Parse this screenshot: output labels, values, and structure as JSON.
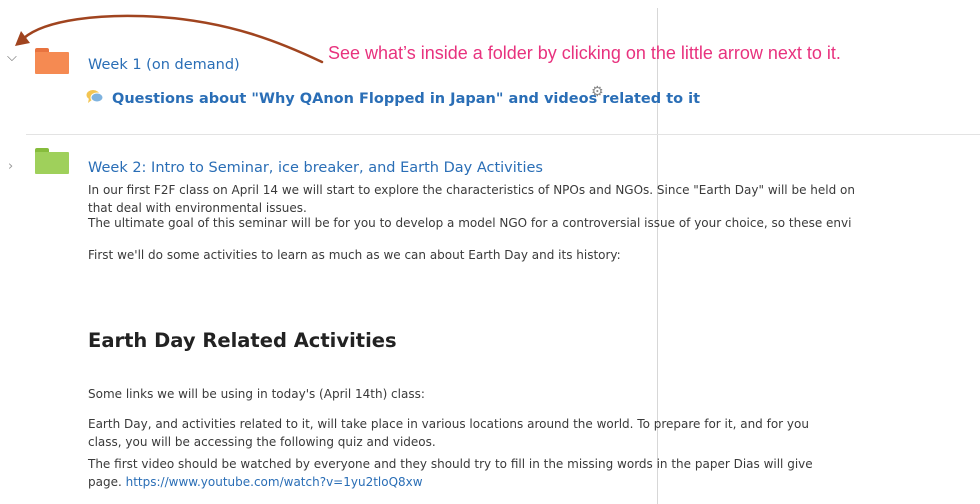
{
  "annotation": "See what’s inside a folder by clicking on the little arrow next to it.",
  "week1": {
    "title": "Week 1 (on demand)",
    "forum_link": "Questions about \"Why QAnon Flopped in Japan\" and videos related to it"
  },
  "week2": {
    "title": "Week 2: Intro to Seminar, ice breaker, and Earth Day Activities",
    "para1_line1": "In our first F2F class on April 14 we will start to explore the characteristics of NPOs and NGOs. Since \"Earth Day\" will be held on",
    "para1_line2": "that deal with environmental issues.",
    "para2": "The ultimate goal of this seminar will be for you to develop a model NGO for a controversial issue of your choice, so these envi",
    "para3": "First we'll do some activities to learn as much as we can about Earth Day and its history:",
    "heading": "Earth Day Related Activities",
    "para4": "Some links we will be using in today's (April 14th) class:",
    "para5_line1": "Earth Day, and activities related to it, will take place in various locations around the world. To prepare for it, and for you",
    "para5_line2": "class, you will be accessing the following quiz and videos.",
    "para6_line1": "The first video should be watched by everyone and they should try to fill in the missing words in the paper Dias will give",
    "para6_line2_prefix": "page. ",
    "video_link": "https://www.youtube.com/watch?v=1yu2tloQ8xw"
  },
  "colors": {
    "annotation": "#e8327e",
    "link": "#2a6eb6",
    "folder_week1": "#f58a52",
    "folder_week2": "#9fd05b"
  },
  "icons": {
    "collapse": "chevron-down-icon",
    "expand": "chevron-right-icon",
    "forum": "forum-speech-bubbles-icon",
    "gear": "gear-icon"
  }
}
